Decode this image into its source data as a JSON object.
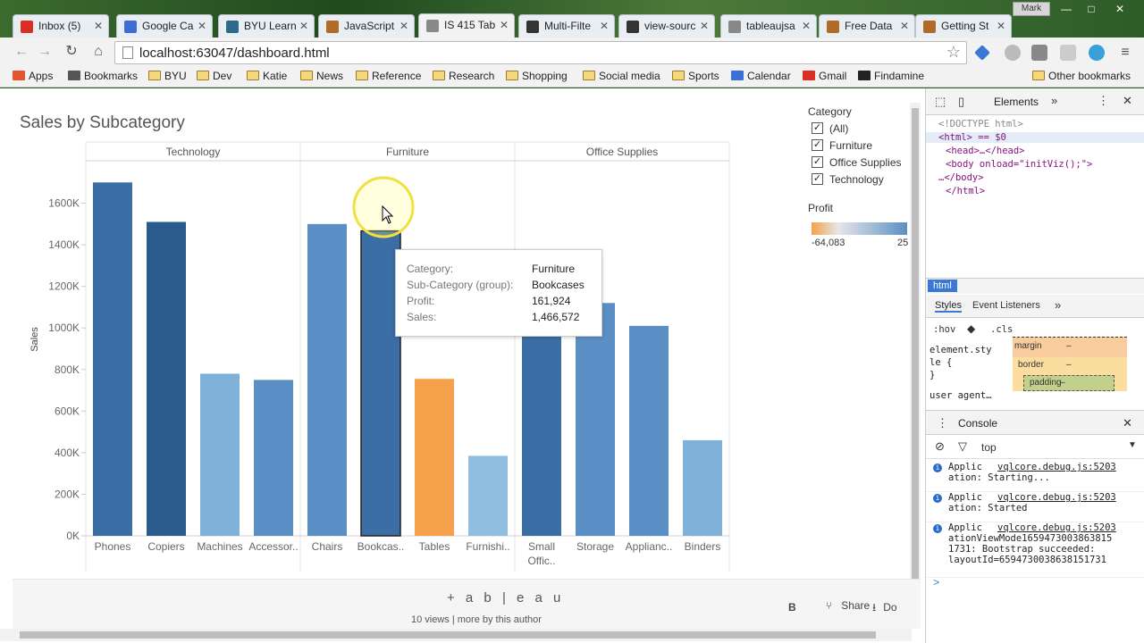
{
  "browser": {
    "tabs": [
      {
        "label": "Inbox (5)",
        "icon": "gmail-icon",
        "color": "#d93025"
      },
      {
        "label": "Google Ca",
        "icon": "google-calendar-icon",
        "color": "#3b6fd6"
      },
      {
        "label": "BYU Learn",
        "icon": "byu-learn-icon",
        "color": "#2e6a8a"
      },
      {
        "label": "JavaScript",
        "icon": "globe-icon",
        "color": "#b06a2a"
      },
      {
        "label": "IS 415 Tab",
        "icon": "document-icon",
        "color": "#888888"
      },
      {
        "label": "Multi-Filte",
        "icon": "js-icon",
        "color": "#333333"
      },
      {
        "label": "view-sourc",
        "icon": "js-icon",
        "color": "#333333"
      },
      {
        "label": "tableaujsa",
        "icon": "document-icon",
        "color": "#888888"
      },
      {
        "label": "Free Data",
        "icon": "globe-icon",
        "color": "#b06a2a"
      },
      {
        "label": "Getting St",
        "icon": "globe-icon",
        "color": "#b06a2a"
      }
    ],
    "active_tab": 4,
    "user": "Mark",
    "url": "localhost:63047/dashboard.html",
    "bookmarks": [
      "Apps",
      "Bookmarks",
      "BYU",
      "Dev",
      "Katie",
      "News",
      "Reference",
      "Research",
      "Shopping",
      "Social media",
      "Sports",
      "Calendar",
      "Gmail",
      "Findamine"
    ],
    "other_bookmarks": "Other bookmarks"
  },
  "viz": {
    "title": "Sales by Subcategory",
    "y_axis_label": "Sales",
    "legend": {
      "title": "Category",
      "items": [
        "(All)",
        "Furniture",
        "Office Supplies",
        "Technology"
      ]
    },
    "profit": {
      "title": "Profit",
      "min": "-64,083",
      "max": "25"
    },
    "tooltip": {
      "rows": [
        {
          "key": "Category:",
          "value": "Furniture"
        },
        {
          "key": "Sub-Category (group):",
          "value": "Bookcases"
        },
        {
          "key": "Profit:",
          "value": "161,924"
        },
        {
          "key": "Sales:",
          "value": "1,466,572"
        }
      ]
    },
    "footer": {
      "logo": "+ a b | e a u",
      "views": "10 views  |  more by this author",
      "share": "Share",
      "bold_button": "B",
      "download": "Do"
    }
  },
  "chart_data": {
    "type": "bar",
    "title": "Sales by Subcategory",
    "ylabel": "Sales",
    "ylim": [
      0,
      1800000
    ],
    "yticks": [
      "0K",
      "200K",
      "400K",
      "600K",
      "800K",
      "1000K",
      "1200K",
      "1400K",
      "1600K"
    ],
    "panels": [
      {
        "name": "Technology",
        "categories": [
          "Phones",
          "Copiers",
          "Machines",
          "Accessor.."
        ],
        "values": [
          1700000,
          1510000,
          780000,
          750000
        ],
        "colors": [
          "#3a6ea5",
          "#2b5a8c",
          "#7fb1d9",
          "#5a8fc5"
        ]
      },
      {
        "name": "Furniture",
        "categories": [
          "Chairs",
          "Bookcas..",
          "Tables",
          "Furnishi.."
        ],
        "values": [
          1500000,
          1466572,
          755000,
          385000
        ],
        "colors": [
          "#5a8fc5",
          "#3a6ea5",
          "#f5a04a",
          "#8fbee0"
        ]
      },
      {
        "name": "Office Supplies",
        "categories": [
          "Small Offic..",
          "Storage",
          "Applianc..",
          "Binders"
        ],
        "values": [
          1000000,
          1120000,
          1010000,
          460000
        ],
        "colors": [
          "#3a6ea5",
          "#5a8fc5",
          "#5a8fc5",
          "#7fb1d9"
        ]
      }
    ],
    "grid": false,
    "legend": "right"
  },
  "devtools": {
    "tabs": [
      "Elements"
    ],
    "dom": [
      "<!DOCTYPE html>",
      "<html> == $0",
      "<head>…</head>",
      "<body onload=\"initViz();\">",
      "…</body>",
      "</html>"
    ],
    "breadcrumb": "html",
    "style_tabs": [
      "Styles",
      "Event Listeners"
    ],
    "filter": ":hov",
    "cls": ".cls",
    "element_style": "element.sty le {",
    "element_style_close": "}",
    "user_agent": "user agent…",
    "box_labels": [
      "margin",
      "border",
      "padding"
    ],
    "box_dash": "–",
    "console_title": "Console",
    "context": "top",
    "messages": [
      {
        "text": "Applic\nation: Starting...",
        "source": "vqlcore.debug.js:5203"
      },
      {
        "text": "Applic\nation: Started",
        "source": "vqlcore.debug.js:5203"
      },
      {
        "text": "Applic\nationViewMode1659473003863815\n1731: Bootstrap succeeded:\nlayoutId=6594730038638151731",
        "source": "vqlcore.debug.js:5203"
      }
    ],
    "prompt": ">"
  }
}
